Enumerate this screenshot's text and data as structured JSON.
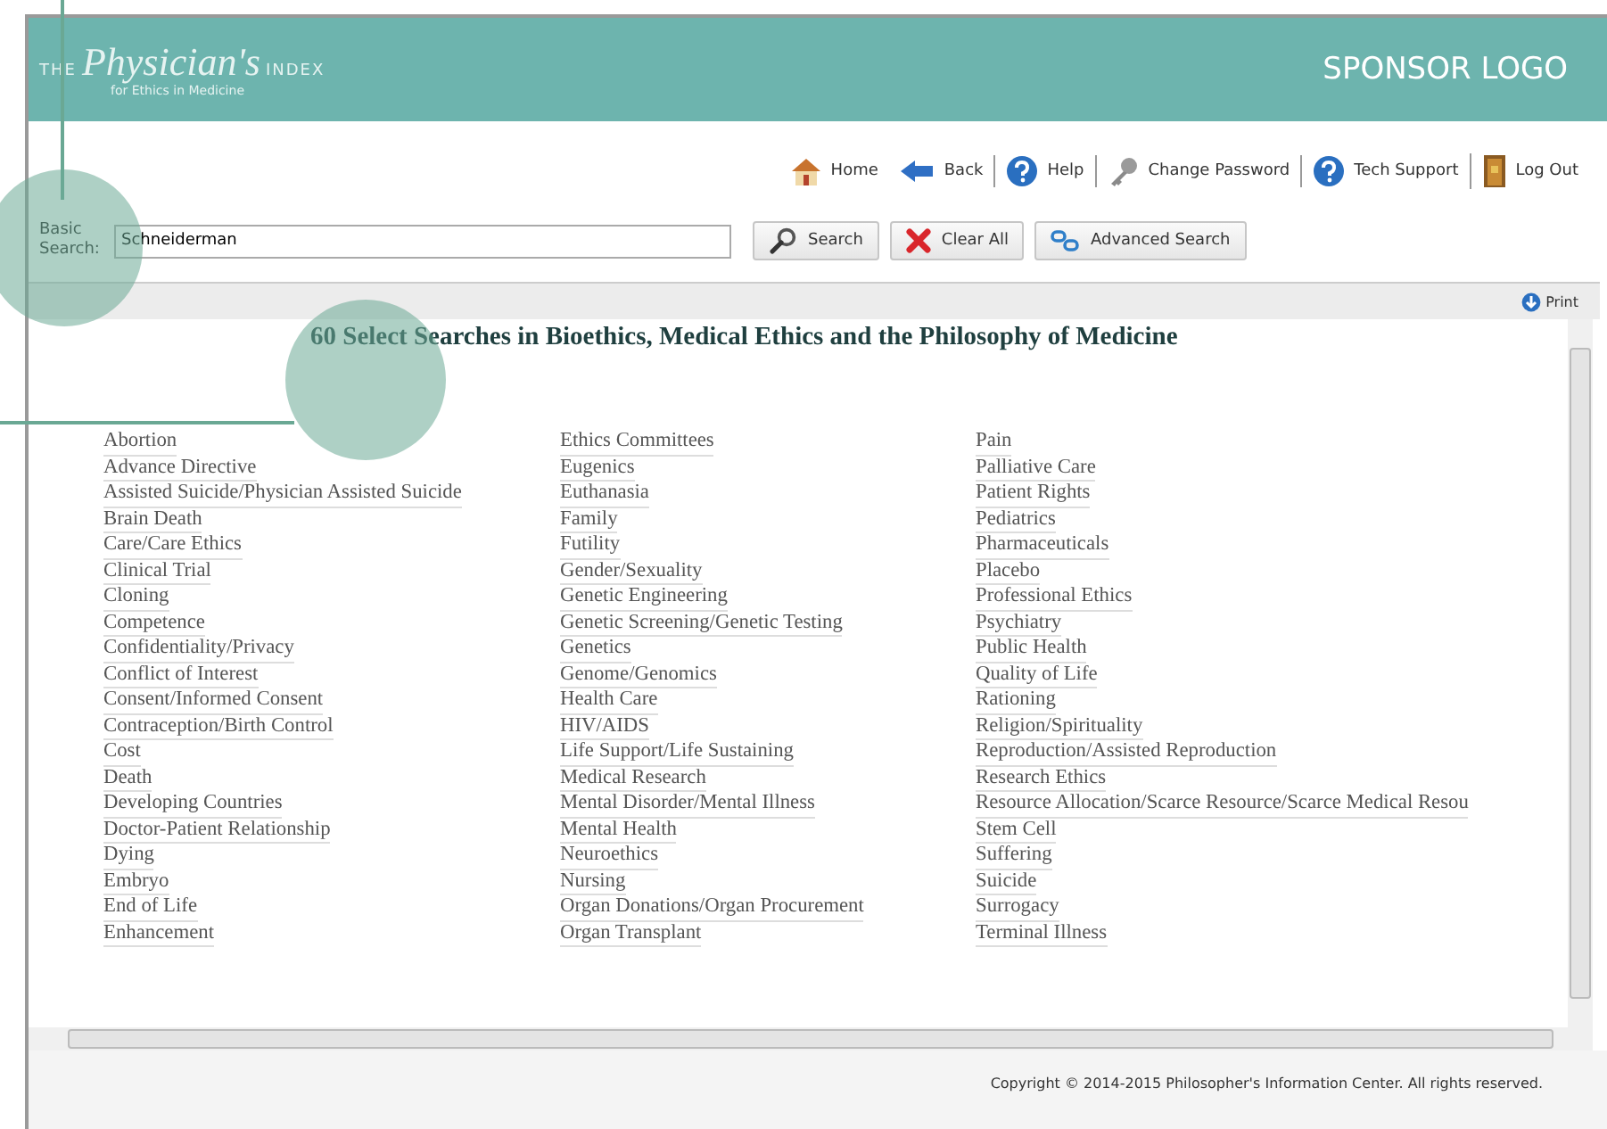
{
  "header": {
    "logo": {
      "prefix": "THE",
      "name": "Physician's",
      "suffix": "INDEX",
      "tagline": "for Ethics in Medicine"
    },
    "sponsor": "SPONSOR LOGO"
  },
  "nav": [
    {
      "kind": "home",
      "label": "Home"
    },
    {
      "kind": "back",
      "label": "Back"
    },
    {
      "kind": "help",
      "label": "Help"
    },
    {
      "kind": "key",
      "label": "Change Password"
    },
    {
      "kind": "help",
      "label": "Tech Support"
    },
    {
      "kind": "door",
      "label": "Log Out"
    }
  ],
  "search": {
    "label": "Basic Search:",
    "value": "Schneiderman",
    "buttons": [
      {
        "kind": "search",
        "label": "Search"
      },
      {
        "kind": "clear",
        "label": "Clear All"
      },
      {
        "kind": "advanced",
        "label": "Advanced Search"
      }
    ]
  },
  "toolbar": {
    "print": "Print"
  },
  "title": "60 Select Searches in Bioethics, Medical Ethics and the Philosophy of Medicine",
  "columns": [
    [
      "Abortion",
      "Advance Directive",
      "Assisted Suicide/Physician Assisted Suicide",
      "Brain Death",
      "Care/Care Ethics",
      "Clinical Trial",
      "Cloning",
      "Competence",
      "Confidentiality/Privacy",
      "Conflict of Interest",
      "Consent/Informed Consent",
      "Contraception/Birth Control",
      "Cost",
      "Death",
      "Developing Countries",
      "Doctor-Patient Relationship",
      "Dying",
      "Embryo",
      "End of Life",
      "Enhancement"
    ],
    [
      "Ethics Committees",
      "Eugenics",
      "Euthanasia",
      "Family",
      "Futility",
      "Gender/Sexuality",
      "Genetic Engineering",
      "Genetic Screening/Genetic Testing",
      "Genetics",
      "Genome/Genomics",
      "Health Care",
      "HIV/AIDS",
      "Life Support/Life Sustaining",
      "Medical Research",
      "Mental Disorder/Mental Illness",
      "Mental Health",
      "Neuroethics",
      "Nursing",
      "Organ Donations/Organ Procurement",
      "Organ Transplant"
    ],
    [
      "Pain",
      "Palliative Care",
      "Patient Rights",
      "Pediatrics",
      "Pharmaceuticals",
      "Placebo",
      "Professional Ethics",
      "Psychiatry",
      "Public Health",
      "Quality of Life",
      "Rationing",
      "Religion/Spirituality",
      "Reproduction/Assisted Reproduction",
      "Research Ethics",
      "Resource Allocation/Scarce Resource/Scarce Medical Resou",
      "Stem Cell",
      "Suffering",
      "Suicide",
      "Surrogacy",
      "Terminal Illness"
    ]
  ],
  "footer": "Copyright © 2014-2015 Philosopher's Information Center. All rights reserved."
}
